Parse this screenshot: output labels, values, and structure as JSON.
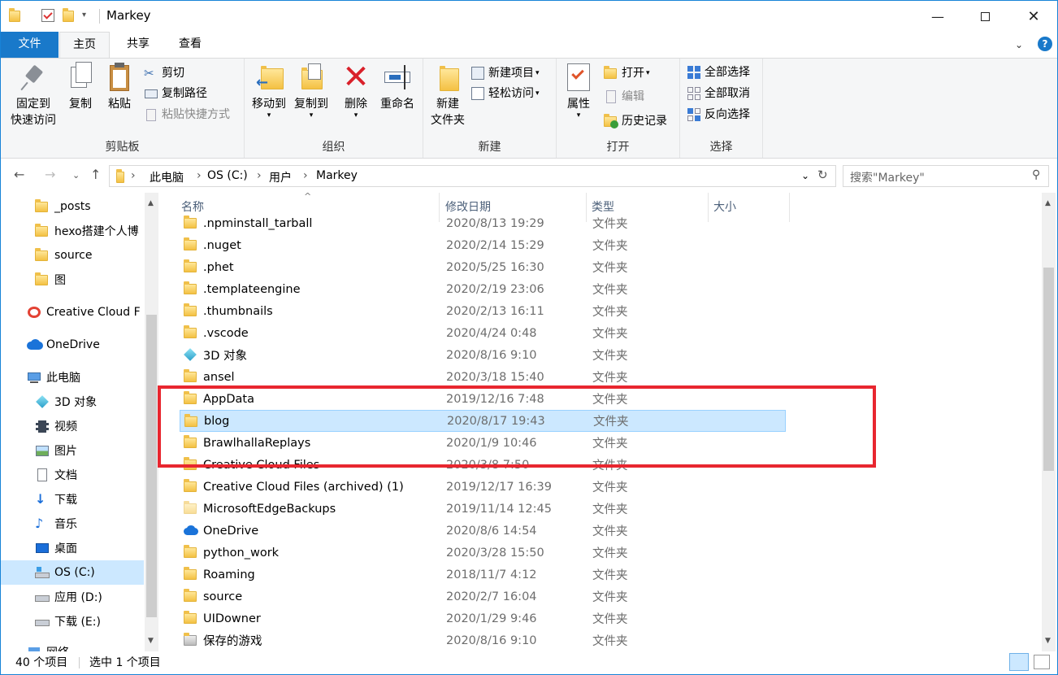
{
  "window": {
    "title": "Markey"
  },
  "tabs": [
    "文件",
    "主页",
    "共享",
    "查看"
  ],
  "ribbon": {
    "clipboard": {
      "label": "剪贴板",
      "pin": "固定到\n快速访问",
      "copy": "复制",
      "paste": "粘贴",
      "cut": "剪切",
      "copy_path": "复制路径",
      "paste_shortcut": "粘贴快捷方式"
    },
    "organize": {
      "label": "组织",
      "move_to": "移动到",
      "copy_to": "复制到",
      "delete": "删除",
      "rename": "重命名"
    },
    "new": {
      "label": "新建",
      "new_folder": "新建\n文件夹",
      "new_item": "新建项目",
      "easy_access": "轻松访问"
    },
    "open": {
      "label": "打开",
      "properties": "属性",
      "open": "打开",
      "edit": "编辑",
      "history": "历史记录"
    },
    "select": {
      "label": "选择",
      "select_all": "全部选择",
      "select_none": "全部取消",
      "invert": "反向选择"
    }
  },
  "address": {
    "crumbs": [
      "此电脑",
      "OS (C:)",
      "用户",
      "Markey"
    ],
    "search_placeholder": "搜索\"Markey\""
  },
  "nav": {
    "items": [
      {
        "label": "_posts",
        "icon": "folder-icon"
      },
      {
        "label": "hexo搭建个人博",
        "icon": "folder-icon"
      },
      {
        "label": "source",
        "icon": "folder-icon"
      },
      {
        "label": "图",
        "icon": "folder-icon"
      },
      {
        "label": "Creative Cloud F",
        "icon": "creative-cloud-icon"
      },
      {
        "label": "OneDrive",
        "icon": "onedrive-icon"
      },
      {
        "label": "此电脑",
        "icon": "pc-icon"
      },
      {
        "label": "3D 对象",
        "icon": "3d-objects-icon"
      },
      {
        "label": "视频",
        "icon": "video-icon"
      },
      {
        "label": "图片",
        "icon": "pictures-icon"
      },
      {
        "label": "文档",
        "icon": "documents-icon"
      },
      {
        "label": "下载",
        "icon": "download-icon"
      },
      {
        "label": "音乐",
        "icon": "music-icon"
      },
      {
        "label": "桌面",
        "icon": "desktop-icon"
      },
      {
        "label": "OS (C:)",
        "icon": "drive-c-icon"
      },
      {
        "label": "应用 (D:)",
        "icon": "drive-icon"
      },
      {
        "label": "下载 (E:)",
        "icon": "drive-icon"
      },
      {
        "label": "网络",
        "icon": "network-icon"
      }
    ]
  },
  "columns": {
    "name": "名称",
    "date": "修改日期",
    "type": "类型",
    "size": "大小"
  },
  "files": [
    {
      "name": ".npminstall_tarball",
      "date": "2020/8/13 19:29",
      "type": "文件夹"
    },
    {
      "name": ".nuget",
      "date": "2020/2/14 15:29",
      "type": "文件夹"
    },
    {
      "name": ".phet",
      "date": "2020/5/25 16:30",
      "type": "文件夹"
    },
    {
      "name": ".templateengine",
      "date": "2020/2/19 23:06",
      "type": "文件夹"
    },
    {
      "name": ".thumbnails",
      "date": "2020/2/13 16:11",
      "type": "文件夹"
    },
    {
      "name": ".vscode",
      "date": "2020/4/24 0:48",
      "type": "文件夹"
    },
    {
      "name": "3D 对象",
      "date": "2020/8/16 9:10",
      "type": "文件夹"
    },
    {
      "name": "ansel",
      "date": "2020/3/18 15:40",
      "type": "文件夹"
    },
    {
      "name": "AppData",
      "date": "2019/12/16 7:48",
      "type": "文件夹"
    },
    {
      "name": "blog",
      "date": "2020/8/17 19:43",
      "type": "文件夹"
    },
    {
      "name": "BrawlhallaReplays",
      "date": "2020/1/9 10:46",
      "type": "文件夹"
    },
    {
      "name": "Creative Cloud Files",
      "date": "2020/3/8 7:50",
      "type": "文件夹"
    },
    {
      "name": "Creative Cloud Files (archived) (1)",
      "date": "2019/12/17 16:39",
      "type": "文件夹"
    },
    {
      "name": "MicrosoftEdgeBackups",
      "date": "2019/11/14 12:45",
      "type": "文件夹"
    },
    {
      "name": "OneDrive",
      "date": "2020/8/6 14:54",
      "type": "文件夹"
    },
    {
      "name": "python_work",
      "date": "2020/3/28 15:50",
      "type": "文件夹"
    },
    {
      "name": "Roaming",
      "date": "2018/11/7 4:12",
      "type": "文件夹"
    },
    {
      "name": "source",
      "date": "2020/2/7 16:04",
      "type": "文件夹"
    },
    {
      "name": "UIDowner",
      "date": "2020/1/29 9:46",
      "type": "文件夹"
    },
    {
      "name": "保存的游戏",
      "date": "2020/8/16 9:10",
      "type": "文件夹"
    }
  ],
  "selected_index": 9,
  "status": {
    "count": "40 个项目",
    "selected": "选中 1 个项目"
  },
  "colors": {
    "accent": "#1979ca",
    "selection": "#cce8ff",
    "highlight_box": "#e8262f"
  }
}
